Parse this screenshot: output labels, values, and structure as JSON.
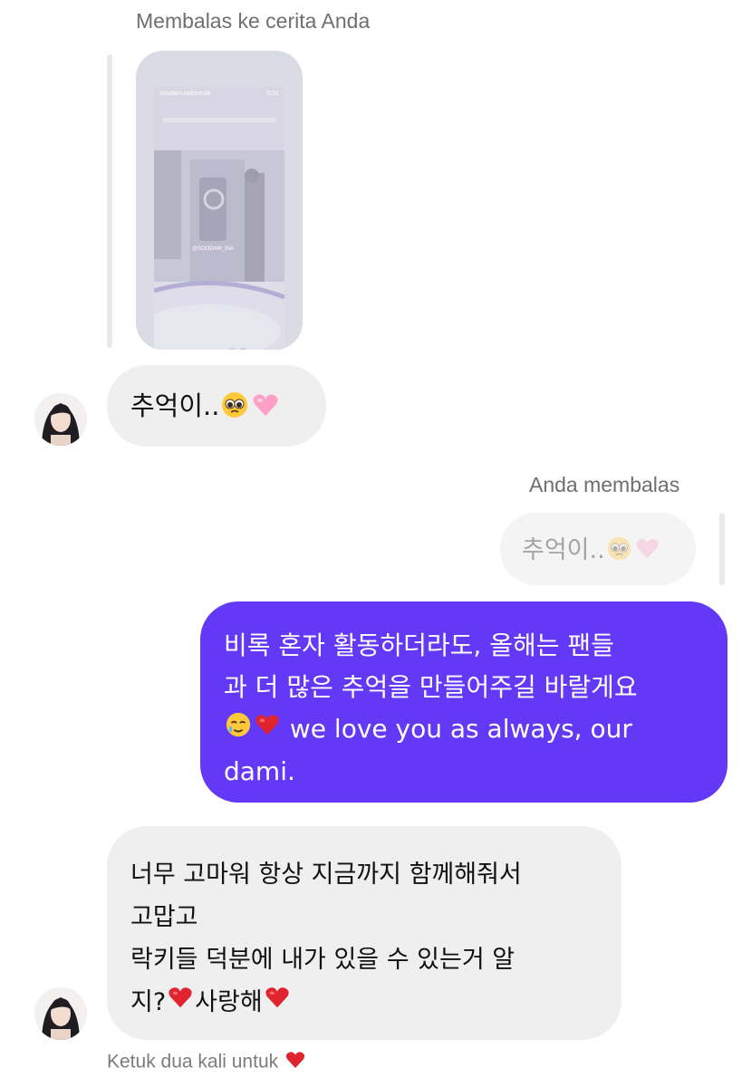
{
  "story_reply": {
    "label": "Membalas ke cerita Anda",
    "story": {
      "account": "soodam.indonesia",
      "time": "0:31",
      "tag": "@SOODAM_INA"
    }
  },
  "messages": [
    {
      "id": "msg1",
      "direction": "incoming",
      "text": "추억이..",
      "emojis": [
        "pleading-face",
        "pink-heart"
      ]
    },
    {
      "id": "msg2",
      "direction": "outgoing",
      "reply_label": "Anda membalas",
      "quoted_text": "추억이..",
      "quoted_emojis": [
        "pleading-face",
        "pink-heart"
      ],
      "lines": [
        "비록 혼자 활동하더라도, 올해는 팬들",
        "과 더 많은 추억을 만들어주길 바랄게요",
        " we love you as always, our",
        "dami."
      ]
    },
    {
      "id": "msg3",
      "direction": "incoming",
      "lines": [
        "너무 고마워 항상 지금까지 함께해줘서",
        "고맙고",
        "락키들 덕분에 내가 있을 수 있는거 알",
        "지?",
        "사랑해"
      ]
    }
  ],
  "footer": {
    "tap_hint": "Ketuk dua kali untuk"
  },
  "colors": {
    "outgoing_bubble": "#6338f6",
    "incoming_bubble": "#efefef",
    "heart_red": "#e0242f",
    "heart_pink": "#ff9fc7"
  }
}
